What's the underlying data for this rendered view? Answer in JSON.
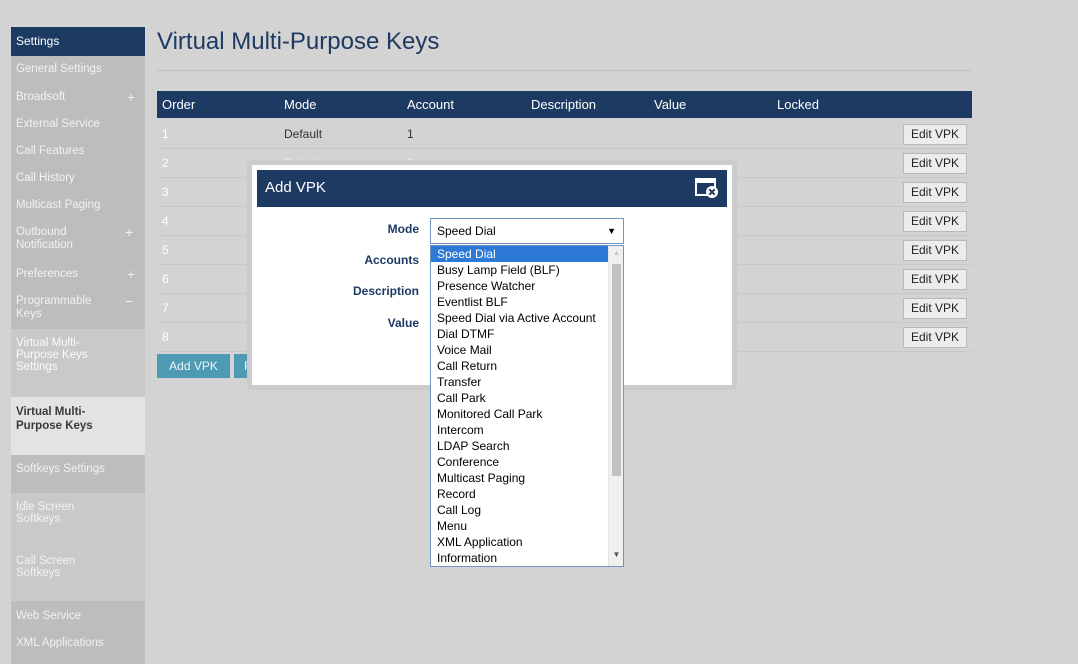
{
  "sidebar": {
    "header": "Settings",
    "items": [
      {
        "label": "General Settings",
        "expand": ""
      },
      {
        "label": "Broadsoft",
        "expand": "+"
      },
      {
        "label": "External Service",
        "expand": ""
      },
      {
        "label": "Call Features",
        "expand": ""
      },
      {
        "label": "Call History",
        "expand": ""
      },
      {
        "label": "Multicast Paging",
        "expand": ""
      },
      {
        "label": "Outbound Notification",
        "expand": "+"
      },
      {
        "label": "Preferences",
        "expand": "+"
      },
      {
        "label": "Programmable Keys",
        "expand": "−"
      },
      {
        "label": "Web Service",
        "expand": ""
      },
      {
        "label": "XML Applications",
        "expand": ""
      }
    ],
    "subitems": [
      {
        "label": "Virtual Multi-Purpose Keys Settings"
      },
      {
        "label": "Virtual Multi-Purpose Keys"
      },
      {
        "label": "Softkeys Settings"
      },
      {
        "label": "Idle Screen Softkeys"
      },
      {
        "label": "Call Screen Softkeys"
      }
    ]
  },
  "page": {
    "title": "Virtual Multi-Purpose Keys"
  },
  "table": {
    "columns": [
      "Order",
      "Mode",
      "Account",
      "Description",
      "Value",
      "Locked"
    ],
    "rows": [
      {
        "order": "1",
        "mode": "Default",
        "account": "1",
        "edit": "Edit VPK"
      },
      {
        "order": "2",
        "mode": "Default",
        "account": "2",
        "edit": "Edit VPK"
      },
      {
        "order": "3",
        "mode": "",
        "account": "",
        "edit": "Edit VPK"
      },
      {
        "order": "4",
        "mode": "",
        "account": "",
        "edit": "Edit VPK"
      },
      {
        "order": "5",
        "mode": "",
        "account": "",
        "edit": "Edit VPK"
      },
      {
        "order": "6",
        "mode": "",
        "account": "",
        "edit": "Edit VPK"
      },
      {
        "order": "7",
        "mode": "",
        "account": "",
        "edit": "Edit VPK"
      },
      {
        "order": "8",
        "mode": "",
        "account": "",
        "edit": "Edit VPK"
      }
    ],
    "add_button": "Add VPK",
    "second_button_partial": "R"
  },
  "dialog": {
    "title": "Add VPK",
    "close_icon": "window-close-icon",
    "labels": {
      "mode": "Mode",
      "accounts": "Accounts",
      "description": "Description",
      "value": "Value"
    },
    "mode_select": {
      "value": "Speed Dial",
      "options": [
        "Speed Dial",
        "Busy Lamp Field (BLF)",
        "Presence Watcher",
        "Eventlist BLF",
        "Speed Dial via Active Account",
        "Dial DTMF",
        "Voice Mail",
        "Call Return",
        "Transfer",
        "Call Park",
        "Monitored Call Park",
        "Intercom",
        "LDAP Search",
        "Conference",
        "Multicast Paging",
        "Record",
        "Call Log",
        "Menu",
        "XML Application",
        "Information"
      ]
    }
  },
  "colors": {
    "navy": "#1d3a63",
    "teal_button": "#4f9ab3",
    "selected_option": "#2c7ad6",
    "overlay": "#d3d3d3"
  }
}
